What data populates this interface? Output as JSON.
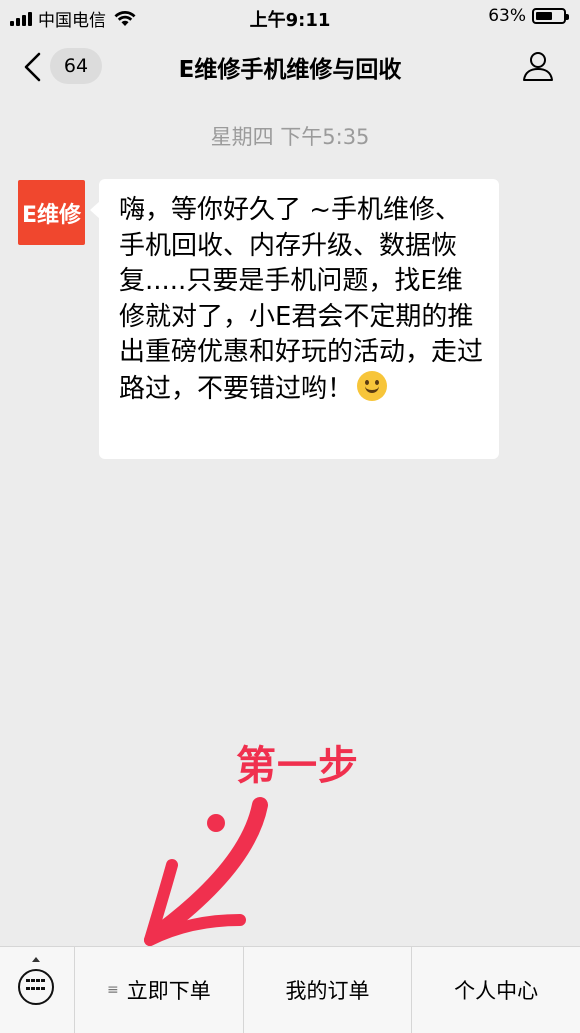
{
  "status_bar": {
    "carrier": "中国电信",
    "time": "上午9:11",
    "battery": "63%",
    "battery_level": 0.63
  },
  "nav": {
    "back_icon": "chevron-left-icon",
    "unread_count": "64",
    "title": "E维修手机维修与回收",
    "profile_icon": "person-icon"
  },
  "chat": {
    "timestamp": "星期四 下午5:35",
    "avatar_text": "E维修",
    "message": "嗨，等你好久了 ~手机维修、手机回收、内存升级、数据恢复.....只要是手机问题，找E维修就对了，小E君会不定期的推出重磅优惠和好玩的活动，走过路过，不要错过哟！"
  },
  "annotation": {
    "text": "第一步",
    "color": "#f0304e"
  },
  "bottom_menu": {
    "keyboard_icon": "keyboard-icon",
    "items": [
      {
        "label": "立即下单",
        "has_submenu": true
      },
      {
        "label": "我的订单"
      },
      {
        "label": "个人中心"
      }
    ]
  }
}
